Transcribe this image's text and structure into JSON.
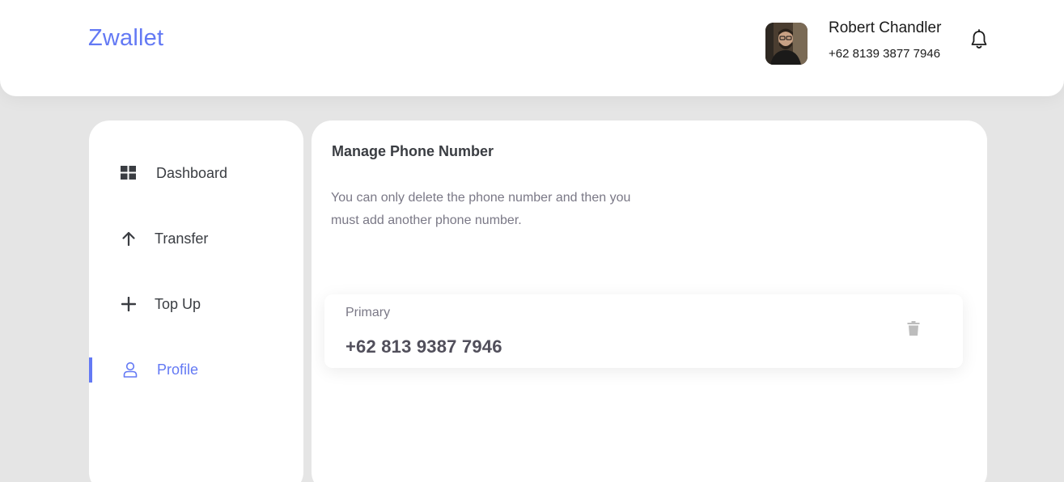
{
  "brand": {
    "name": "Zwallet",
    "color": "#6379f4"
  },
  "user": {
    "name": "Robert Chandler",
    "phone": "+62 8139 3877 7946",
    "avatar_icon": "user-photo"
  },
  "header": {
    "notification_icon": "bell-icon"
  },
  "sidebar": {
    "items": [
      {
        "label": "Dashboard",
        "icon": "grid-icon",
        "active": false
      },
      {
        "label": "Transfer",
        "icon": "arrow-up-icon",
        "active": false
      },
      {
        "label": "Top Up",
        "icon": "plus-icon",
        "active": false
      },
      {
        "label": "Profile",
        "icon": "user-icon",
        "active": true
      }
    ]
  },
  "main": {
    "title": "Manage Phone Number",
    "description": "You can only delete the phone number and then you must add another phone number.",
    "phone_card": {
      "label": "Primary",
      "number": "+62 813 9387 7946",
      "delete_icon": "trash-icon"
    }
  }
}
